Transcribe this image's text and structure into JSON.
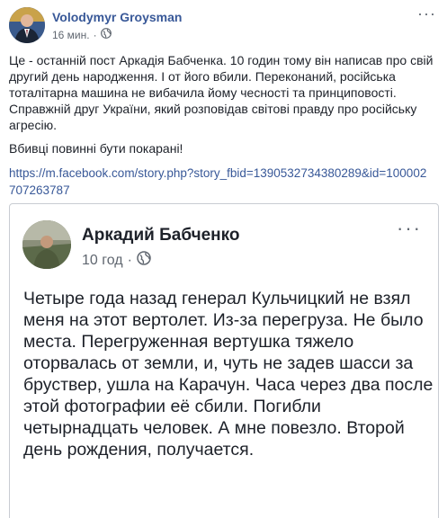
{
  "post": {
    "author": "Volodymyr Groysman",
    "time": "16 мин.",
    "dot": "·",
    "paragraph1": "Це - останній пост Аркадія Бабченка. 10 годин тому він написав про свій другий день народження. І от його вбили. Переконаний, російська тоталітарна машина не вибачила йому чесності та принциповості. Справжній друг України, який розповідав світові правду про російську агресію.",
    "paragraph2": "Вбивці повинні бути покарані!",
    "link": "https://m.facebook.com/story.php?story_fbid=1390532734380289&id=100002707263787",
    "menu": "···",
    "audience_icon": "globe-icon"
  },
  "shared": {
    "author": "Аркадий Бабченко",
    "time": "10 год",
    "dot": "·",
    "menu": "···",
    "audience_icon": "globe-icon",
    "text": "Четыре года назад генерал Кульчицкий не взял меня на этот вертолет. Из-за перегруза. Не было места. Перегруженная вертушка тяжело оторвалась от земли, и, чуть не задев шасси за бруствер, ушла на Карачун. Часа через два после этой фотографии её сбили. Погибли четырнадцать человек. А мне повезло. Второй день рождения, получается."
  }
}
